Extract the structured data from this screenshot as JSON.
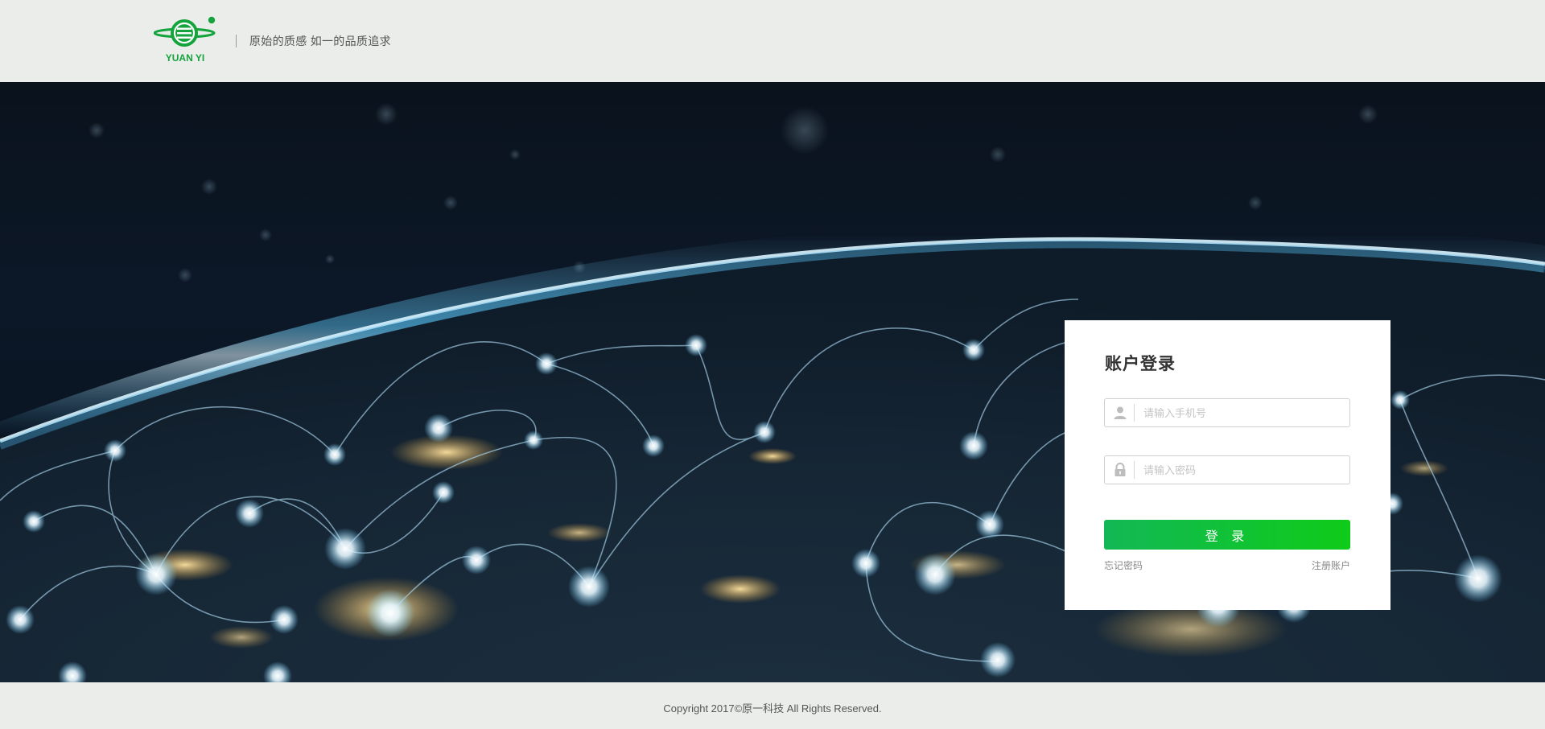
{
  "header": {
    "brand": "YUAN YI",
    "slogan": "原始的质感 如一的品质追求",
    "brand_color": "#14a33c"
  },
  "login": {
    "title": "账户登录",
    "phone_placeholder": "请输入手机号",
    "phone_value": "",
    "password_placeholder": "请输入密码",
    "password_value": "",
    "submit_label": "登 录",
    "forgot_link": "忘记密码",
    "register_link": "注册账户",
    "phone_icon": "user-icon",
    "password_icon": "lock-icon",
    "button_color_start": "#12b855",
    "button_color_end": "#0fcb19"
  },
  "footer": {
    "copyright": "Copyright 2017©原一科技 All Rights Reserved."
  }
}
